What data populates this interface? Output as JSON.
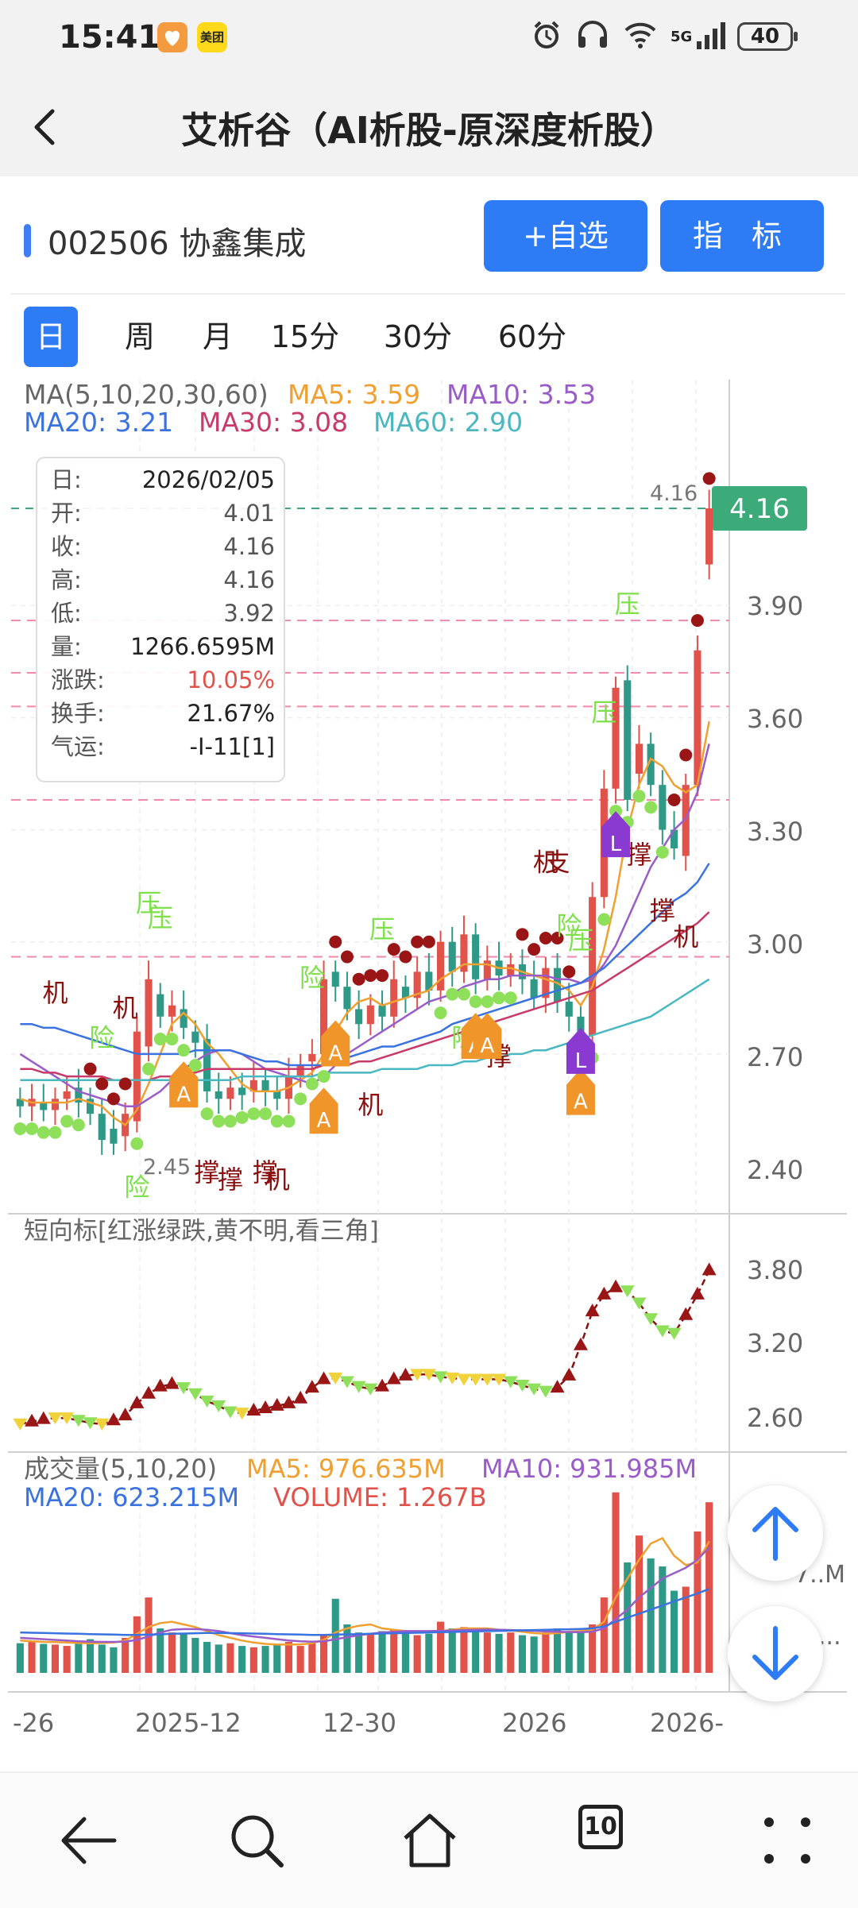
{
  "status_bar": {
    "time": "15:41",
    "app_badge_text": "美团",
    "network": "5G",
    "battery": "40",
    "icons": [
      "alarm-icon",
      "headset-icon",
      "wifi-icon",
      "signal-icon",
      "battery-icon"
    ]
  },
  "header": {
    "title": "艾析谷（AI析股-原深度析股）"
  },
  "stock": {
    "code_name": "002506 协鑫集成",
    "add_watch_label": "+自选",
    "indicator_label": "指 标"
  },
  "period_tabs": [
    {
      "label": "日",
      "active": true
    },
    {
      "label": "周",
      "active": false
    },
    {
      "label": "月",
      "active": false
    },
    {
      "label": "15分",
      "active": false
    },
    {
      "label": "30分",
      "active": false
    },
    {
      "label": "60分",
      "active": false
    }
  ],
  "ma_legend": {
    "title": "MA(5,10,20,30,60)",
    "ma5": "MA5: 3.59",
    "ma10": "MA10: 3.53",
    "ma20": "MA20: 3.21",
    "ma30": "MA30: 3.08",
    "ma60": "MA60: 2.90"
  },
  "info_box": [
    {
      "label": "日:",
      "value": "2026/02/05"
    },
    {
      "label": "开:",
      "value": "4.01"
    },
    {
      "label": "收:",
      "value": "4.16"
    },
    {
      "label": "高:",
      "value": "4.16"
    },
    {
      "label": "低:",
      "value": "3.92"
    },
    {
      "label": "量:",
      "value": "1266.6595M"
    },
    {
      "label": "涨跌:",
      "value": "10.05%"
    },
    {
      "label": "换手:",
      "value": "21.67%"
    },
    {
      "label": "气运:",
      "value": "-I-11[1]"
    }
  ],
  "colors": {
    "up": "#e0524a",
    "down": "#2f9988",
    "ma5": "#f0a030",
    "ma10": "#9a5cc8",
    "ma20": "#3a72e0",
    "ma30": "#c83a6a",
    "ma60": "#4ab8c0",
    "accent": "#2d7cf6",
    "price_tag": "#3daa7a",
    "green_dot": "#8ee05a",
    "red_dot": "#9a1515"
  },
  "chart_data": [
    {
      "type": "candlestick",
      "title": "MA(5,10,20,30,60)",
      "y_ticks": [
        "3.90",
        "3.60",
        "3.30",
        "3.00",
        "2.70",
        "2.40"
      ],
      "ylim": [
        2.4,
        4.16
      ],
      "x_ticks": [
        "-26",
        "2025-12",
        "12-30",
        "2026",
        "2026-"
      ],
      "current_price": "4.16",
      "high_label": "4.16",
      "low_label": "2.45",
      "grid": true,
      "candles": [
        {
          "o": 2.58,
          "c": 2.56
        },
        {
          "o": 2.56,
          "c": 2.58
        },
        {
          "o": 2.57,
          "c": 2.55
        },
        {
          "o": 2.55,
          "c": 2.58
        },
        {
          "o": 2.58,
          "c": 2.6
        },
        {
          "o": 2.61,
          "c": 2.57
        },
        {
          "o": 2.58,
          "c": 2.54
        },
        {
          "o": 2.54,
          "c": 2.47
        },
        {
          "o": 2.5,
          "c": 2.46
        },
        {
          "o": 2.48,
          "c": 2.54
        },
        {
          "o": 2.52,
          "c": 2.76
        },
        {
          "o": 2.72,
          "c": 2.9
        },
        {
          "o": 2.86,
          "c": 2.8
        },
        {
          "o": 2.8,
          "c": 2.83
        },
        {
          "o": 2.82,
          "c": 2.77
        },
        {
          "o": 2.76,
          "c": 2.73
        },
        {
          "o": 2.74,
          "c": 2.6
        },
        {
          "o": 2.6,
          "c": 2.58
        },
        {
          "o": 2.58,
          "c": 2.61
        },
        {
          "o": 2.61,
          "c": 2.59
        },
        {
          "o": 2.6,
          "c": 2.63
        },
        {
          "o": 2.63,
          "c": 2.6
        },
        {
          "o": 2.6,
          "c": 2.58
        },
        {
          "o": 2.58,
          "c": 2.64
        },
        {
          "o": 2.64,
          "c": 2.67
        },
        {
          "o": 2.68,
          "c": 2.7
        },
        {
          "o": 2.7,
          "c": 2.9
        },
        {
          "o": 2.92,
          "c": 2.88
        },
        {
          "o": 2.88,
          "c": 2.82
        },
        {
          "o": 2.82,
          "c": 2.78
        },
        {
          "o": 2.78,
          "c": 2.83
        },
        {
          "o": 2.83,
          "c": 2.8
        },
        {
          "o": 2.8,
          "c": 2.9
        },
        {
          "o": 2.88,
          "c": 2.85
        },
        {
          "o": 2.85,
          "c": 2.92
        },
        {
          "o": 2.92,
          "c": 2.87
        },
        {
          "o": 2.87,
          "c": 3.0
        },
        {
          "o": 3.0,
          "c": 2.92
        },
        {
          "o": 2.92,
          "c": 3.02
        },
        {
          "o": 3.02,
          "c": 2.9
        },
        {
          "o": 2.9,
          "c": 2.95
        },
        {
          "o": 2.95,
          "c": 2.91
        },
        {
          "o": 2.91,
          "c": 2.94
        },
        {
          "o": 2.94,
          "c": 2.9
        },
        {
          "o": 2.9,
          "c": 2.85
        },
        {
          "o": 2.85,
          "c": 2.93
        },
        {
          "o": 2.93,
          "c": 2.84
        },
        {
          "o": 2.84,
          "c": 2.8
        },
        {
          "o": 2.8,
          "c": 2.75
        },
        {
          "o": 2.75,
          "c": 3.12
        },
        {
          "o": 3.12,
          "c": 3.41
        },
        {
          "o": 3.41,
          "c": 3.68
        },
        {
          "o": 3.7,
          "c": 3.38
        },
        {
          "o": 3.45,
          "c": 3.53
        },
        {
          "o": 3.53,
          "c": 3.42
        },
        {
          "o": 3.42,
          "c": 3.3
        },
        {
          "o": 3.3,
          "c": 3.25
        },
        {
          "o": 3.23,
          "c": 3.42
        },
        {
          "o": 3.42,
          "c": 3.78
        },
        {
          "o": 4.01,
          "c": 4.16
        }
      ],
      "ma_series": [
        {
          "name": "MA5",
          "values": [
            2.58,
            2.57,
            2.57,
            2.57,
            2.57,
            2.58,
            2.57,
            2.56,
            2.53,
            2.51,
            2.55,
            2.62,
            2.7,
            2.78,
            2.81,
            2.78,
            2.73,
            2.7,
            2.66,
            2.62,
            2.6,
            2.6,
            2.6,
            2.61,
            2.63,
            2.65,
            2.7,
            2.76,
            2.81,
            2.84,
            2.85,
            2.83,
            2.84,
            2.85,
            2.86,
            2.87,
            2.9,
            2.92,
            2.94,
            2.94,
            2.94,
            2.93,
            2.93,
            2.92,
            2.91,
            2.9,
            2.89,
            2.87,
            2.83,
            2.88,
            2.98,
            3.12,
            3.3,
            3.42,
            3.49,
            3.47,
            3.42,
            3.4,
            3.42,
            3.59
          ]
        },
        {
          "name": "MA10",
          "values": [
            2.7,
            2.68,
            2.66,
            2.64,
            2.62,
            2.6,
            2.59,
            2.58,
            2.57,
            2.56,
            2.56,
            2.58,
            2.6,
            2.63,
            2.66,
            2.68,
            2.7,
            2.71,
            2.71,
            2.7,
            2.68,
            2.66,
            2.65,
            2.64,
            2.63,
            2.62,
            2.64,
            2.67,
            2.7,
            2.72,
            2.74,
            2.76,
            2.78,
            2.8,
            2.82,
            2.84,
            2.85,
            2.86,
            2.88,
            2.89,
            2.9,
            2.9,
            2.91,
            2.91,
            2.91,
            2.91,
            2.9,
            2.9,
            2.89,
            2.9,
            2.94,
            2.99,
            3.06,
            3.13,
            3.2,
            3.25,
            3.3,
            3.33,
            3.4,
            3.53
          ]
        },
        {
          "name": "MA20",
          "values": [
            2.78,
            2.78,
            2.77,
            2.77,
            2.76,
            2.75,
            2.74,
            2.73,
            2.72,
            2.71,
            2.7,
            2.7,
            2.7,
            2.7,
            2.7,
            2.71,
            2.71,
            2.71,
            2.71,
            2.7,
            2.69,
            2.68,
            2.68,
            2.67,
            2.67,
            2.67,
            2.67,
            2.68,
            2.69,
            2.7,
            2.71,
            2.72,
            2.72,
            2.73,
            2.74,
            2.75,
            2.76,
            2.78,
            2.79,
            2.8,
            2.81,
            2.82,
            2.83,
            2.84,
            2.85,
            2.86,
            2.87,
            2.88,
            2.89,
            2.91,
            2.93,
            2.96,
            2.99,
            3.02,
            3.05,
            3.08,
            3.11,
            3.13,
            3.16,
            3.21
          ]
        },
        {
          "name": "MA30",
          "values": [
            2.66,
            2.66,
            2.65,
            2.65,
            2.64,
            2.64,
            2.64,
            2.64,
            2.63,
            2.63,
            2.63,
            2.63,
            2.64,
            2.64,
            2.65,
            2.65,
            2.66,
            2.66,
            2.66,
            2.66,
            2.66,
            2.66,
            2.66,
            2.66,
            2.66,
            2.66,
            2.67,
            2.67,
            2.67,
            2.68,
            2.68,
            2.69,
            2.7,
            2.71,
            2.72,
            2.73,
            2.74,
            2.75,
            2.76,
            2.77,
            2.78,
            2.79,
            2.8,
            2.81,
            2.82,
            2.83,
            2.84,
            2.85,
            2.86,
            2.87,
            2.89,
            2.91,
            2.93,
            2.95,
            2.97,
            2.99,
            3.01,
            3.03,
            3.05,
            3.08
          ]
        },
        {
          "name": "MA60",
          "values": [
            2.63,
            2.63,
            2.63,
            2.63,
            2.63,
            2.63,
            2.63,
            2.63,
            2.63,
            2.63,
            2.63,
            2.63,
            2.63,
            2.63,
            2.63,
            2.63,
            2.63,
            2.63,
            2.63,
            2.64,
            2.64,
            2.64,
            2.64,
            2.64,
            2.64,
            2.64,
            2.65,
            2.65,
            2.65,
            2.65,
            2.65,
            2.66,
            2.66,
            2.66,
            2.66,
            2.67,
            2.67,
            2.67,
            2.68,
            2.68,
            2.69,
            2.69,
            2.7,
            2.7,
            2.71,
            2.71,
            2.72,
            2.73,
            2.74,
            2.75,
            2.76,
            2.77,
            2.78,
            2.79,
            2.8,
            2.82,
            2.84,
            2.86,
            2.88,
            2.9
          ]
        }
      ],
      "signals": [
        {
          "label": "机",
          "i": 3,
          "kind": "red"
        },
        {
          "label": "险",
          "i": 7,
          "kind": "green"
        },
        {
          "label": "机",
          "i": 9,
          "kind": "red"
        },
        {
          "label": "压",
          "i": 11,
          "kind": "green"
        },
        {
          "label": "压",
          "i": 12,
          "kind": "green"
        },
        {
          "label": "险",
          "i": 10,
          "kind": "green-low"
        },
        {
          "label": "撑",
          "i": 16,
          "kind": "red-low"
        },
        {
          "label": "撑",
          "i": 18,
          "kind": "red-low"
        },
        {
          "label": "撑",
          "i": 21,
          "kind": "red-low"
        },
        {
          "label": "机",
          "i": 22,
          "kind": "red-low"
        },
        {
          "label": "险",
          "i": 25,
          "kind": "green"
        },
        {
          "label": "压",
          "i": 31,
          "kind": "green"
        },
        {
          "label": "机",
          "i": 30,
          "kind": "red-low"
        },
        {
          "label": "险",
          "i": 38,
          "kind": "green-low"
        },
        {
          "label": "撑",
          "i": 41,
          "kind": "red-low"
        },
        {
          "label": "机",
          "i": 45,
          "kind": "red"
        },
        {
          "label": "支",
          "i": 46,
          "kind": "red"
        },
        {
          "label": "险",
          "i": 47,
          "kind": "green"
        },
        {
          "label": "压",
          "i": 48,
          "kind": "green"
        },
        {
          "label": "压",
          "i": 50,
          "kind": "green"
        },
        {
          "label": "压",
          "i": 52,
          "kind": "green"
        },
        {
          "label": "撑",
          "i": 53,
          "kind": "red-low"
        },
        {
          "label": "撑",
          "i": 55,
          "kind": "red-low"
        },
        {
          "label": "机",
          "i": 57,
          "kind": "red-low"
        }
      ],
      "markers": [
        {
          "label": "A",
          "i": 14,
          "kind": "A"
        },
        {
          "label": "A",
          "i": 26,
          "kind": "A"
        },
        {
          "label": "A",
          "i": 27,
          "kind": "A"
        },
        {
          "label": "A",
          "i": 39,
          "kind": "A"
        },
        {
          "label": "A",
          "i": 40,
          "kind": "A"
        },
        {
          "label": "A",
          "i": 48,
          "kind": "A"
        },
        {
          "label": "L",
          "i": 48,
          "kind": "L"
        },
        {
          "label": "L",
          "i": 51,
          "kind": "L"
        }
      ]
    },
    {
      "type": "line",
      "title": "短向标[红涨绿跌,黄不明,看三角]",
      "y_ticks": [
        "3.80",
        "3.20",
        "2.60"
      ],
      "ylim": [
        2.45,
        4.0
      ],
      "values": [
        2.55,
        2.57,
        2.59,
        2.6,
        2.6,
        2.58,
        2.56,
        2.55,
        2.58,
        2.62,
        2.72,
        2.8,
        2.86,
        2.88,
        2.85,
        2.8,
        2.74,
        2.7,
        2.65,
        2.64,
        2.66,
        2.68,
        2.7,
        2.72,
        2.76,
        2.85,
        2.92,
        2.93,
        2.9,
        2.86,
        2.84,
        2.86,
        2.92,
        2.95,
        2.96,
        2.96,
        2.94,
        2.93,
        2.92,
        2.92,
        2.92,
        2.92,
        2.9,
        2.87,
        2.84,
        2.82,
        2.85,
        2.95,
        3.2,
        3.48,
        3.62,
        3.68,
        3.65,
        3.55,
        3.42,
        3.32,
        3.3,
        3.45,
        3.62,
        3.82
      ]
    },
    {
      "type": "bar",
      "title": "成交量(5,10,20)",
      "legend": {
        "ma5": "MA5: 976.635M",
        "ma10": "MA10: 931.985M",
        "ma20": "MA20: 623.215M",
        "volume": "VOLUME: 1.267B"
      },
      "y_ticks": [
        "7..M",
        "..."
      ],
      "values": [
        220,
        230,
        215,
        210,
        200,
        240,
        250,
        210,
        190,
        260,
        420,
        560,
        330,
        300,
        290,
        260,
        230,
        210,
        220,
        200,
        190,
        200,
        210,
        230,
        200,
        220,
        280,
        550,
        360,
        300,
        290,
        310,
        320,
        300,
        280,
        290,
        380,
        330,
        340,
        310,
        300,
        290,
        300,
        280,
        270,
        300,
        330,
        310,
        300,
        360,
        560,
        1340,
        820,
        1020,
        850,
        790,
        610,
        640,
        1050,
        1267
      ],
      "ma5": [
        240,
        235,
        230,
        228,
        225,
        222,
        220,
        222,
        225,
        240,
        290,
        340,
        370,
        380,
        360,
        340,
        310,
        280,
        260,
        240,
        225,
        215,
        210,
        210,
        212,
        220,
        245,
        300,
        330,
        350,
        360,
        330,
        320,
        310,
        300,
        300,
        310,
        320,
        330,
        330,
        330,
        320,
        315,
        305,
        295,
        290,
        295,
        305,
        310,
        320,
        380,
        560,
        700,
        840,
        960,
        1000,
        870,
        800,
        820,
        976
      ],
      "ma10": [
        260,
        255,
        250,
        245,
        240,
        235,
        232,
        230,
        230,
        232,
        245,
        270,
        300,
        320,
        325,
        325,
        320,
        310,
        295,
        280,
        270,
        260,
        250,
        240,
        235,
        232,
        235,
        250,
        265,
        280,
        290,
        300,
        305,
        310,
        310,
        310,
        312,
        315,
        318,
        320,
        322,
        320,
        318,
        315,
        312,
        308,
        305,
        303,
        302,
        306,
        330,
        400,
        470,
        560,
        630,
        700,
        740,
        780,
        840,
        931
      ],
      "ma20": [
        300,
        298,
        296,
        294,
        292,
        290,
        288,
        286,
        284,
        282,
        282,
        284,
        286,
        290,
        292,
        294,
        296,
        296,
        295,
        294,
        292,
        290,
        288,
        286,
        284,
        282,
        282,
        284,
        286,
        288,
        290,
        292,
        294,
        296,
        298,
        300,
        302,
        304,
        306,
        308,
        310,
        312,
        314,
        316,
        318,
        320,
        322,
        324,
        326,
        330,
        345,
        380,
        410,
        440,
        470,
        500,
        530,
        560,
        590,
        623
      ]
    }
  ],
  "bottom_nav": {
    "tab_count": "10"
  }
}
